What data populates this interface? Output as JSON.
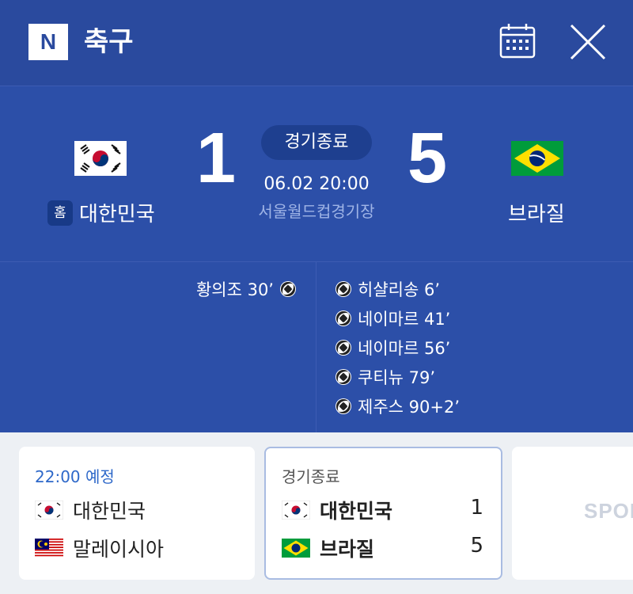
{
  "header": {
    "logo": "N",
    "title": "축구",
    "calendar_icon": "calendar-icon",
    "close_icon": "close-icon"
  },
  "match": {
    "status": "경기종료",
    "datetime": "06.02 20:00",
    "venue": "서울월드컵경기장",
    "home": {
      "badge": "홈",
      "name": "대한민국",
      "score": "1",
      "flag": "south-korea-flag"
    },
    "away": {
      "name": "브라질",
      "score": "5",
      "flag": "brazil-flag"
    }
  },
  "events": {
    "home": [
      {
        "text": "황의조 30’",
        "icon": "soccer-ball-icon"
      }
    ],
    "away": [
      {
        "text": "히샬리송 6’",
        "icon": "soccer-ball-icon"
      },
      {
        "text": "네이마르 41’",
        "icon": "soccer-ball-icon"
      },
      {
        "text": "네이마르 56’",
        "icon": "soccer-ball-icon"
      },
      {
        "text": "쿠티뉴 79’",
        "icon": "soccer-ball-icon"
      },
      {
        "text": "제주스 90+2’",
        "icon": "soccer-ball-icon"
      }
    ]
  },
  "cards": [
    {
      "status": "22:00 예정",
      "status_color": "#2e68c9",
      "teams": [
        {
          "name": "대한민국",
          "flag": "south-korea-flag"
        },
        {
          "name": "말레이시아",
          "flag": "malaysia-flag"
        }
      ]
    },
    {
      "status": "경기종료",
      "status_color": "#555555",
      "teams": [
        {
          "name": "대한민국",
          "flag": "south-korea-flag",
          "score": "1"
        },
        {
          "name": "브라질",
          "flag": "brazil-flag",
          "score": "5"
        }
      ]
    },
    {
      "sponsor": "SPON"
    }
  ],
  "colors": {
    "header_bg": "#2a4a9e",
    "score_bg": "#2c4fa8",
    "accent_blue": "#2e68c9"
  }
}
